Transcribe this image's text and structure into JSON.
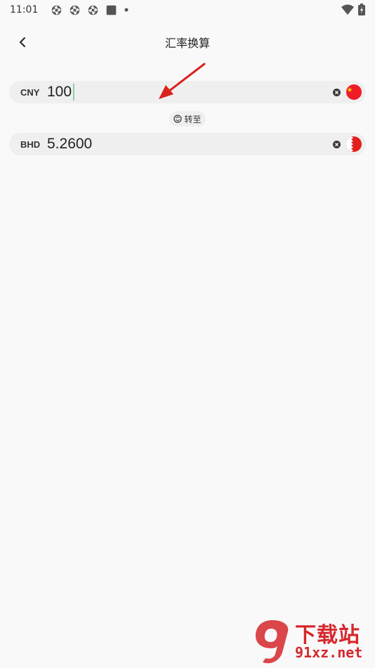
{
  "status_bar": {
    "time": "11:01",
    "left_icons": [
      "aperture-icon",
      "aperture-icon",
      "aperture-icon",
      "square-icon",
      "dot-icon"
    ],
    "right_icons": [
      "wifi-icon",
      "battery-icon"
    ]
  },
  "header": {
    "back_icon": "chevron-left-icon",
    "title": "汇率换算"
  },
  "rows": [
    {
      "code": "CNY",
      "value": "100",
      "flag": "china-flag",
      "flag_color": "#ee1c25",
      "clear_icon": "clear-icon"
    },
    {
      "code": "BHD",
      "value": "5.2600",
      "flag": "bahrain-flag",
      "flag_color": "#e0201c",
      "clear_icon": "clear-icon"
    }
  ],
  "swap": {
    "icon": "swap-icon",
    "label": "转至"
  },
  "annotation": {
    "color": "#d9221c"
  },
  "watermark": {
    "logo_text": "下载站",
    "domain_text": "91xz.net",
    "color": "#d6272d"
  }
}
